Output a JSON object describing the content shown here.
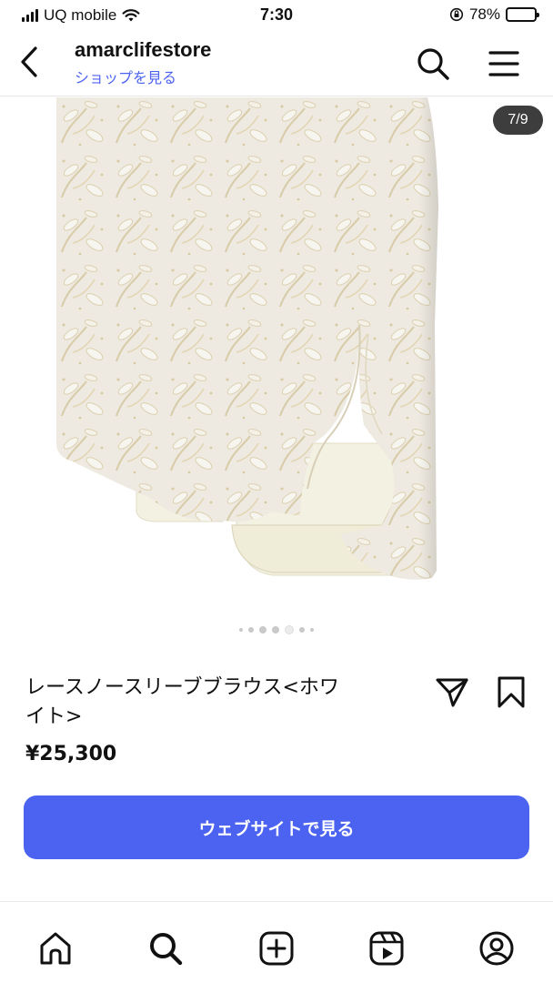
{
  "status_bar": {
    "carrier": "UQ mobile",
    "time": "7:30",
    "battery_percent": "78%",
    "battery_level": 0.78
  },
  "header": {
    "title": "amarclifestore",
    "subtitle": "ショップを見る",
    "back_icon": "chevron-left-icon",
    "search_icon": "search-icon",
    "menu_icon": "menu-icon"
  },
  "gallery": {
    "counter": "7/9",
    "total_images": 9,
    "current_index": 7
  },
  "product": {
    "title_line1": "レースノースリーブブラウス<ホワ",
    "title_line2": "イト>",
    "price": "¥25,300",
    "cta_label": "ウェブサイトで見る",
    "share_icon": "send-icon",
    "save_icon": "bookmark-icon"
  },
  "bottom_nav": {
    "items": [
      "home-icon",
      "search-icon",
      "create-icon",
      "reels-icon",
      "profile-icon"
    ]
  },
  "colors": {
    "accent": "#4c63f1",
    "counter_bg": "#3d3d3d"
  }
}
